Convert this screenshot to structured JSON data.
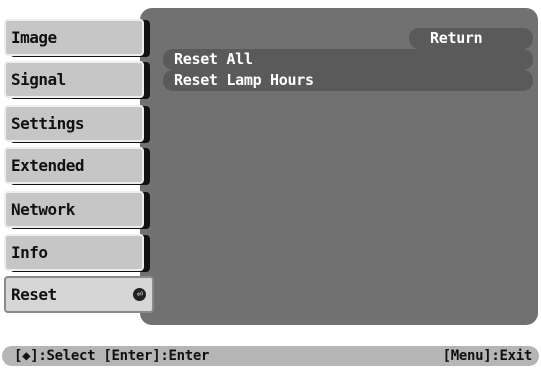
{
  "sidebar": {
    "items": [
      {
        "label": "Image"
      },
      {
        "label": "Signal"
      },
      {
        "label": "Settings"
      },
      {
        "label": "Extended"
      },
      {
        "label": "Network"
      },
      {
        "label": "Info"
      },
      {
        "label": "Reset",
        "icon": "enter-icon",
        "icon_glyph": "⏎"
      }
    ]
  },
  "main": {
    "return_label": "Return",
    "options": [
      {
        "label": "Reset All"
      },
      {
        "label": "Reset Lamp Hours"
      }
    ]
  },
  "status_bar": {
    "left_text": "[◆]:Select [Enter]:Enter",
    "right_text": "[Menu]:Exit"
  }
}
